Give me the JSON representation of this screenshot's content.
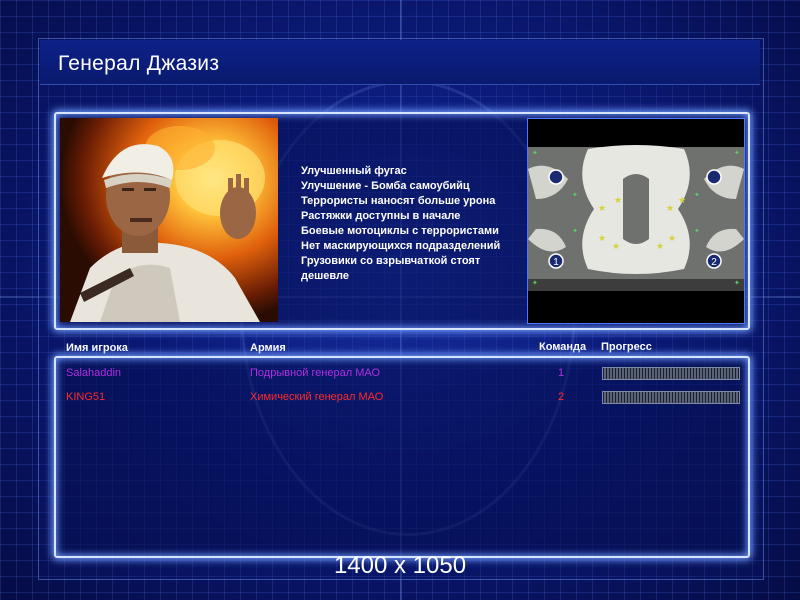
{
  "window": {
    "title": "Генерал Джазиз"
  },
  "general": {
    "portrait_icon": "general-portrait-image",
    "description": "Улучшенный фугас\nУлучшение - Бомба самоубийц\nТеррористы наносят больше урона\nРастяжки доступны в начале\nБоевые мотоциклы с террористами\nНет маскирующихся подразделений\nГрузовики со взрывчаткой стоят\n дешевле"
  },
  "map": {
    "icon": "minimap-image",
    "start_positions": [
      "1",
      "2"
    ]
  },
  "players_table": {
    "headers": {
      "name": "Имя игрока",
      "army": "Армия",
      "team": "Команда",
      "progress": "Прогресс"
    },
    "rows": [
      {
        "name": "Salahaddin",
        "army": "Подрывной генерал МАО",
        "team": "1",
        "progress": 0.0,
        "color": "#b030e0"
      },
      {
        "name": "KING51",
        "army": "Химический генерал МАО",
        "team": "2",
        "progress": 0.0,
        "color": "#ff2a2a"
      }
    ]
  },
  "footer": {
    "resolution": "1400 x 1050"
  },
  "colors": {
    "background": "#0b1a78",
    "glow": "#6f9bff",
    "player1": "#b030e0",
    "player2": "#ff2a2a"
  }
}
